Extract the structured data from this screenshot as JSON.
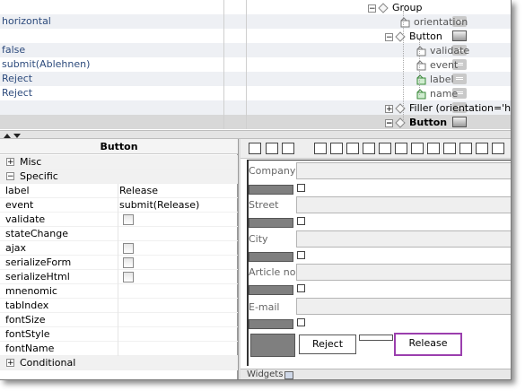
{
  "top_table": {
    "values": [
      "horizontal",
      "false",
      "submit(Ablehnen)",
      "Reject",
      "Reject"
    ]
  },
  "tree": {
    "group": "Group",
    "orientation": "orientation",
    "button": "Button",
    "validate": "validate",
    "event": "event",
    "label": "label",
    "name": "name",
    "filler": "Filler (orientation='hor",
    "button_selected": "Button"
  },
  "properties": {
    "title": "Button",
    "misc": "Misc",
    "specific": "Specific",
    "rows": [
      {
        "key": "label",
        "value": "Release"
      },
      {
        "key": "event",
        "value": "submit(Release)"
      },
      {
        "key": "validate",
        "value": ""
      },
      {
        "key": "stateChange",
        "value": ""
      },
      {
        "key": "ajax",
        "value": ""
      },
      {
        "key": "serializeForm",
        "value": ""
      },
      {
        "key": "serializeHtml",
        "value": ""
      },
      {
        "key": "mnenomic",
        "value": ""
      },
      {
        "key": "tabIndex",
        "value": ""
      },
      {
        "key": "fontSize",
        "value": ""
      },
      {
        "key": "fontStyle",
        "value": ""
      },
      {
        "key": "fontName",
        "value": ""
      }
    ],
    "conditional": "Conditional"
  },
  "form": {
    "fields": [
      "Company",
      "Street",
      "City",
      "Article no.",
      "E-mail"
    ],
    "reject_button": "Reject",
    "release_button": "Release",
    "selected_color": "#9b3fae"
  },
  "footer": {
    "widgets_label": "Widgets"
  }
}
